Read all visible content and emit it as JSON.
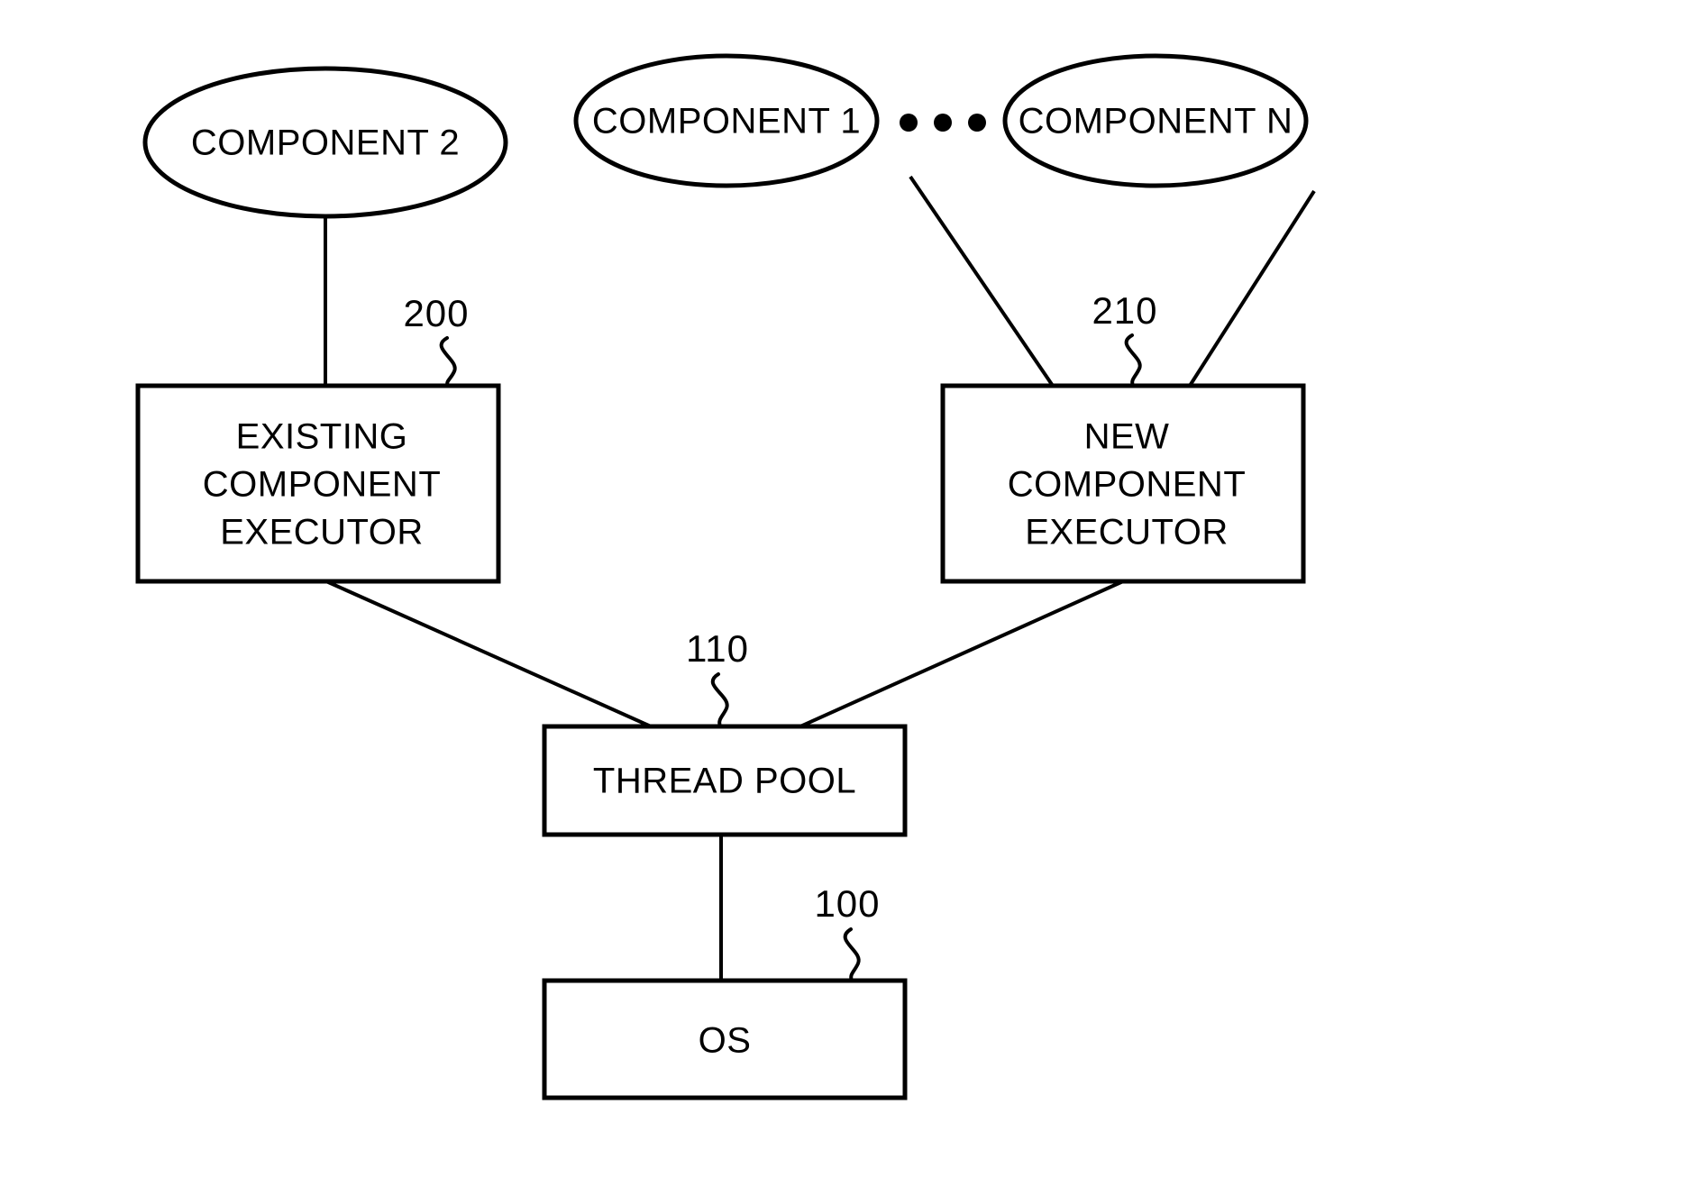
{
  "figure": {
    "type": "block-diagram",
    "description": "Component execution architecture block diagram",
    "background_color": "#ffffff",
    "line_color": "#000000"
  },
  "nodes": {
    "component_2": {
      "label": "COMPONENT 2",
      "shape": "ellipse"
    },
    "component_1": {
      "label": "COMPONENT 1",
      "shape": "ellipse"
    },
    "component_n": {
      "label": "COMPONENT N",
      "shape": "ellipse"
    },
    "ellipsis": {
      "label": "• • •",
      "shape": "dots",
      "count": 3
    },
    "existing_executor": {
      "line1": "EXISTING",
      "line2": "COMPONENT",
      "line3": "EXECUTOR",
      "shape": "rectangle"
    },
    "new_executor": {
      "line1": "NEW",
      "line2": "COMPONENT",
      "line3": "EXECUTOR",
      "shape": "rectangle"
    },
    "thread_pool": {
      "label": "THREAD POOL",
      "shape": "rectangle"
    },
    "os": {
      "label": "OS",
      "shape": "rectangle"
    }
  },
  "reference_numerals": {
    "existing_executor": "200",
    "new_executor": "210",
    "thread_pool": "110",
    "os": "100"
  },
  "connections": [
    {
      "from": "component_2",
      "to": "existing_executor"
    },
    {
      "from": "component_1",
      "to": "new_executor"
    },
    {
      "from": "component_n",
      "to": "new_executor"
    },
    {
      "from": "existing_executor",
      "to": "thread_pool"
    },
    {
      "from": "new_executor",
      "to": "thread_pool"
    },
    {
      "from": "thread_pool",
      "to": "os"
    }
  ]
}
